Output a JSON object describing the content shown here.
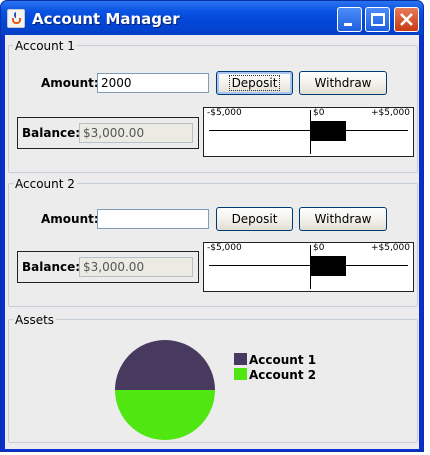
{
  "window": {
    "title": "Account Manager"
  },
  "accounts": [
    {
      "panel_title": "Account 1",
      "amount_label": "Amount:",
      "amount_value": "2000",
      "deposit_label": "Deposit",
      "withdraw_label": "Withdraw",
      "balance_label": "Balance:",
      "balance_value": "$3,000.00",
      "gauge": {
        "min_label": "-$5,000",
        "zero_label": "$0",
        "max_label": "+$5,000",
        "min": -5000,
        "max": 5000,
        "value": 3000
      }
    },
    {
      "panel_title": "Account 2",
      "amount_label": "Amount:",
      "amount_value": "",
      "deposit_label": "Deposit",
      "withdraw_label": "Withdraw",
      "balance_label": "Balance:",
      "balance_value": "$3,000.00",
      "gauge": {
        "min_label": "-$5,000",
        "zero_label": "$0",
        "max_label": "+$5,000",
        "min": -5000,
        "max": 5000,
        "value": 3000
      }
    }
  ],
  "assets": {
    "panel_title": "Assets",
    "legend": [
      {
        "name": "Account 1",
        "color": "#483a5e",
        "value": 3000
      },
      {
        "name": "Account 2",
        "color": "#4fe612",
        "value": 3000
      }
    ]
  }
}
